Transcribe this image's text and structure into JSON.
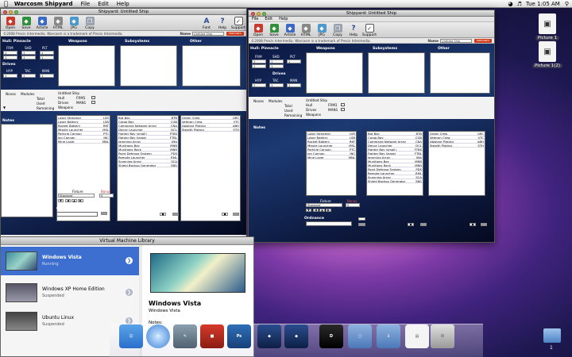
{
  "menubar": {
    "app": "Warcosm Shipyard",
    "items": [
      "File",
      "Edit",
      "Help"
    ],
    "clock": "Tue 1:05 AM"
  },
  "desktop": {
    "icons": [
      "Picture 1",
      "Picture 1(2)"
    ],
    "stack_badge": "1"
  },
  "windows": [
    {
      "id": "w1",
      "title": "Shipyard: Untitled Ship",
      "menu": [],
      "toolbar": [
        "Open",
        "Save",
        "Article",
        "HTML",
        "JPG",
        "Copy"
      ],
      "toolbar_right": [
        "Font",
        "Help",
        "Support"
      ],
      "copyright": "©2008 Precis Intermedia. Warcosm is a trademark of Precis Intermedia.",
      "name_label": "Name",
      "name_value": "Untitled Ship",
      "logo": "warcosm"
    },
    {
      "id": "w2",
      "title": "Shipyard: Untitled Ship",
      "menu": [
        "File",
        "Edit",
        "Help"
      ],
      "toolbar": [
        "Open",
        "Save",
        "Article",
        "HTML",
        "JPG",
        "Copy"
      ],
      "toolbar_right": [
        "Help",
        "Support"
      ],
      "copyright": "©2008 Precis Intermedia. Warcosm is a trademark of Precis Intermedia.",
      "name_label": "Name",
      "name_value": "Untitled Ship",
      "logo": "warcosm"
    }
  ],
  "ship": {
    "hull_pinnacle": "Hull: Pinnacle",
    "frm": "FRM",
    "shd": "SHD",
    "plt": "PLT",
    "drives": "Drives",
    "hyp": "HYP",
    "tac": "TAC",
    "man": "MAN",
    "weapons": "Weapons",
    "subsystems": "Subsystems",
    "other": "Other",
    "novas": "Novas",
    "modules": "Modules",
    "total": "Total",
    "used": "Used",
    "remaining": "Remaining",
    "ship_name": "Untitled Ship",
    "hull": "Hull",
    "drives_l": "Drives",
    "weapons_l": "Weapons",
    "frm1": "FRM1",
    "man1": "MAN1",
    "notes": "Notes",
    "fixture": "Fixture",
    "standard": "Standard",
    "bonus": "Bonus",
    "bonus_val": "0",
    "ordnance": "Ordnance",
    "weapons_list": [
      [
        "Laser Streamer",
        "LSR"
      ],
      [
        "Laser Battery",
        "LSB"
      ],
      [
        "Rocket Battery",
        "RKT"
      ],
      [
        "Missile Launcher",
        "MSL"
      ],
      [
        "Particle Cannon",
        "PTC"
      ],
      [
        "Ion Cannon",
        "INC"
      ],
      [
        "Mine Layer",
        "MNL"
      ]
    ],
    "subsystems_list": [
      [
        "Bot Bay",
        "BTB"
      ],
      [
        "Cargo Bay",
        "CGB"
      ],
      [
        "Command Network Array",
        "CNA"
      ],
      [
        "Decoy Launcher",
        "DCL"
      ],
      [
        "Fighter Bay (small)",
        "FTBS"
      ],
      [
        "Fighter Bay (large)",
        "FTBL"
      ],
      [
        "Jamming Array",
        "JMA"
      ],
      [
        "Munitions Bay",
        "MNB"
      ],
      [
        "Munitions Rack",
        "MNR"
      ],
      [
        "Point Defense System",
        "PDS"
      ],
      [
        "Remote Launcher",
        "RML"
      ],
      [
        "Scanning Array",
        "SCA"
      ],
      [
        "Shield Backup Generator",
        "SBG"
      ]
    ],
    "other_list": [
      [
        "Green Crew",
        "GRC"
      ],
      [
        "Veteran Crew",
        "VTC"
      ],
      [
        "Ablative Plating",
        "ABH"
      ],
      [
        "Stealth Plating",
        "STH"
      ]
    ]
  },
  "vm": {
    "title": "Virtual Machine Library",
    "items": [
      {
        "name": "Windows Vista",
        "status": "Running"
      },
      {
        "name": "Windows XP Home Edition",
        "status": "Suspended"
      },
      {
        "name": "Ubuntu Linux",
        "status": "Suspended"
      }
    ],
    "detail_name": "Windows Vista",
    "detail_os": "Windows Vista",
    "notes": "Notes:"
  },
  "dock": {
    "ps_label": "Ps",
    "d_label": "D"
  },
  "colors": {
    "accent": "#3d6fd1",
    "warcosm_red": "#d13b1c",
    "panel_blue": "#1c3a73"
  }
}
